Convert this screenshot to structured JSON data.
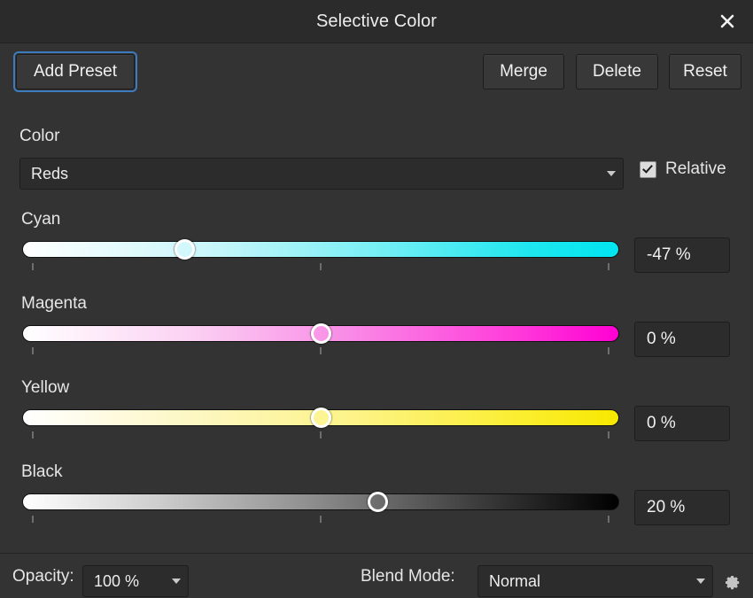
{
  "window": {
    "title": "Selective Color",
    "close_icon": "close-x-icon"
  },
  "toolbar": {
    "add_preset_label": "Add Preset",
    "merge_label": "Merge",
    "delete_label": "Delete",
    "reset_label": "Reset"
  },
  "color_section": {
    "label": "Color",
    "selected": "Reds",
    "caret_icon": "chevron-down-icon",
    "relative_label": "Relative",
    "relative_checked": true
  },
  "sliders": [
    {
      "name": "cyan",
      "label": "Cyan",
      "value": "-47 %",
      "percent": -47,
      "min": -100,
      "max": 100,
      "handle_pct": 27.2,
      "accent": "#00e5f0"
    },
    {
      "name": "magenta",
      "label": "Magenta",
      "value": "0 %",
      "percent": 0,
      "min": -100,
      "max": 100,
      "handle_pct": 50,
      "accent": "#ff00d4"
    },
    {
      "name": "yellow",
      "label": "Yellow",
      "value": "0 %",
      "percent": 0,
      "min": -100,
      "max": 100,
      "handle_pct": 50,
      "accent": "#f7e800"
    },
    {
      "name": "black",
      "label": "Black",
      "value": "20 %",
      "percent": 20,
      "min": -100,
      "max": 100,
      "handle_pct": 59.5,
      "accent": "#000000"
    }
  ],
  "footer": {
    "opacity_label": "Opacity:",
    "opacity_value": "100 %",
    "blend_label": "Blend Mode:",
    "blend_value": "Normal",
    "settings_icon": "gear-icon",
    "caret_icon": "chevron-down-icon"
  },
  "colors": {
    "window_bg": "#333333",
    "titlebar_bg": "#2b2b2b",
    "focus_ring": "#3d7bbf",
    "text": "#ededed"
  }
}
